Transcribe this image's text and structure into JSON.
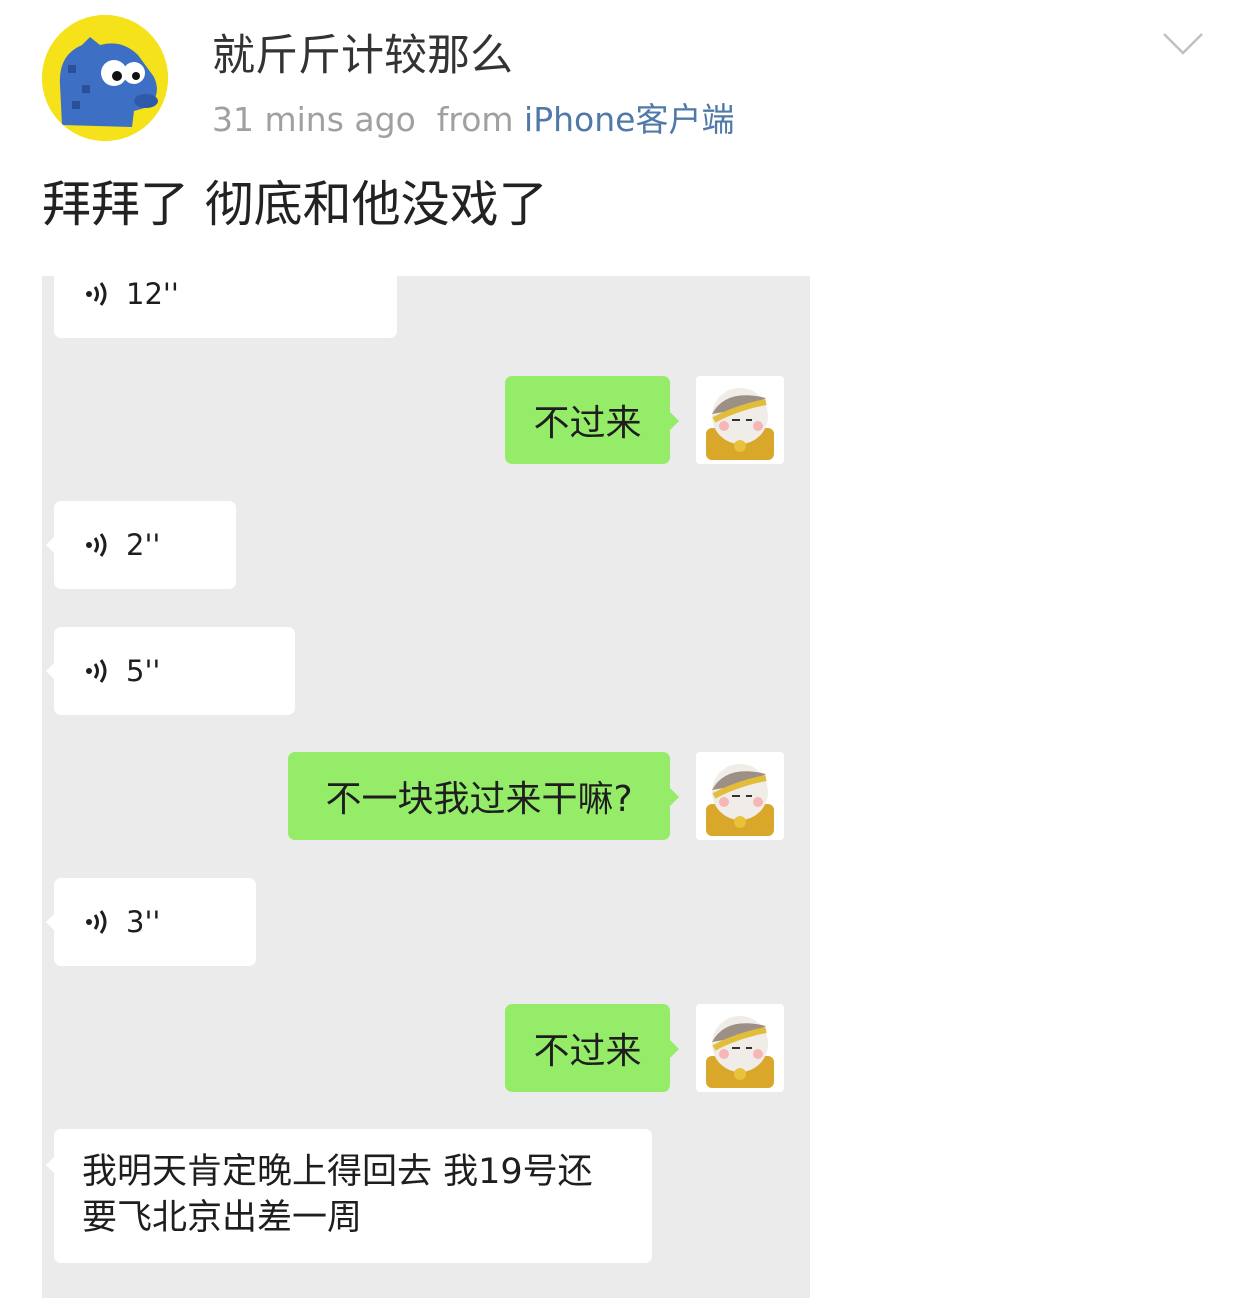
{
  "post": {
    "username": "就斤斤计较那么",
    "time": "31 mins ago",
    "from_label": "from",
    "source": "iPhone客户端",
    "text": "拜拜了 彻底和他没戏了"
  },
  "chat": {
    "voice_messages": [
      "12''",
      "2''",
      "5''",
      "3''"
    ],
    "outgoing_messages": [
      "不过来",
      "不一块我过来干嘛?",
      "不过来"
    ],
    "incoming_text_line1": "我明天肯定晚上得回去 我19号还",
    "incoming_text_line2": "要飞北京出差一周"
  },
  "icons": {
    "voice": "voice-wave-icon",
    "menu": "chevron-down-icon"
  },
  "colors": {
    "outgoing_bubble": "#95ec69",
    "chat_background": "#ebebeb",
    "source_link": "#5078a8",
    "avatar_background": "#f5e21a"
  }
}
